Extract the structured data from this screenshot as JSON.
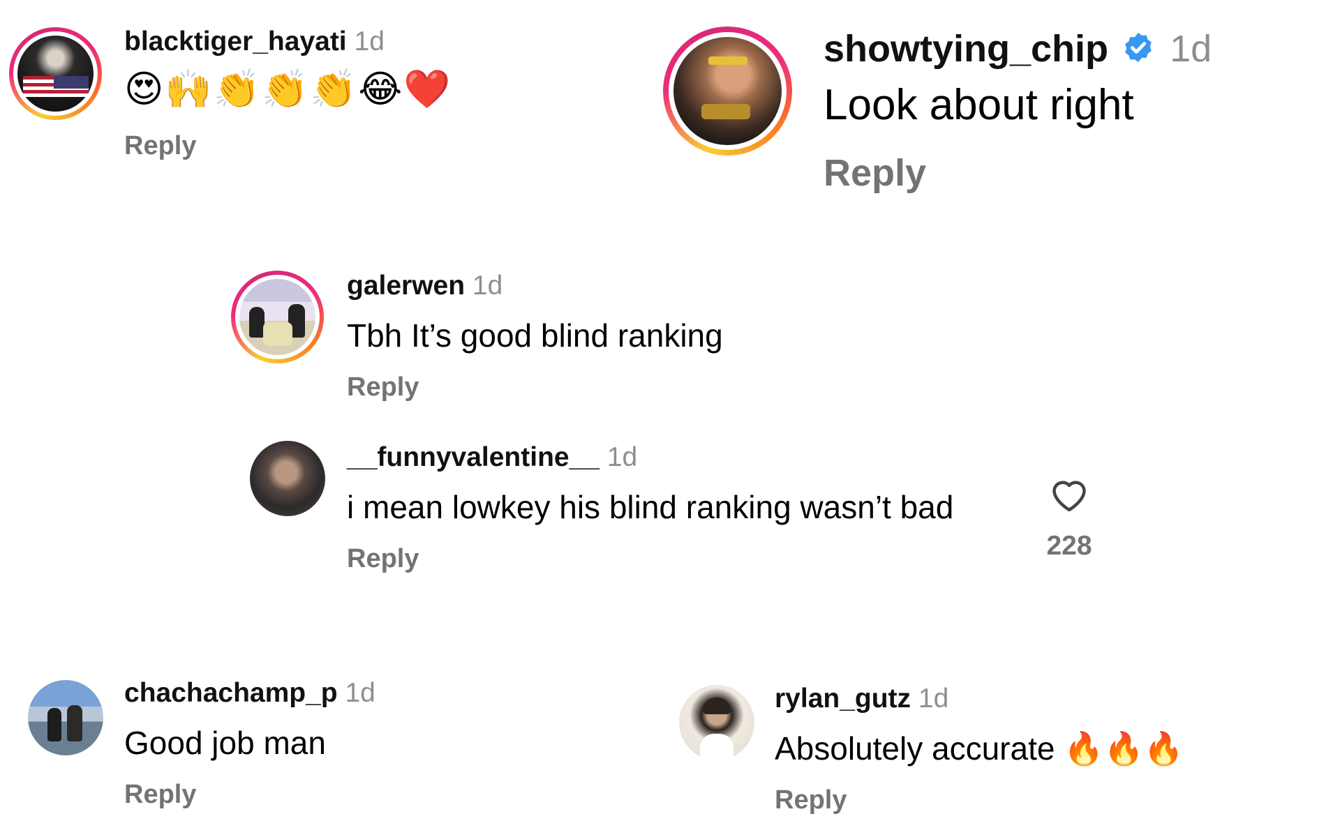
{
  "comments": [
    {
      "username": "blacktiger_hayati",
      "time": "1d",
      "text": "😍🙌👏👏👏😂❤️",
      "reply_label": "Reply"
    },
    {
      "username": "showtying_chip",
      "time": "1d",
      "verified": true,
      "text": "Look about right",
      "reply_label": "Reply"
    },
    {
      "username": "galerwen",
      "time": "1d",
      "text": "Tbh It’s good blind ranking",
      "reply_label": "Reply"
    },
    {
      "username": "__funnyvalentine__",
      "time": "1d",
      "text": "i mean lowkey his blind ranking wasn’t bad",
      "reply_label": "Reply",
      "likes": "228"
    },
    {
      "username": "chachachamp_p",
      "time": "1d",
      "text": "Good job man",
      "reply_label": "Reply"
    },
    {
      "username": "rylan_gutz",
      "time": "1d",
      "text": "Absolutely accurate 🔥🔥🔥",
      "reply_label": "Reply"
    }
  ],
  "icons": {
    "verified": "verified-badge-icon",
    "like": "heart-outline-icon"
  },
  "colors": {
    "username": "#111111",
    "meta": "#8e8e8e",
    "reply": "#737373",
    "verified": "#3897f0"
  }
}
